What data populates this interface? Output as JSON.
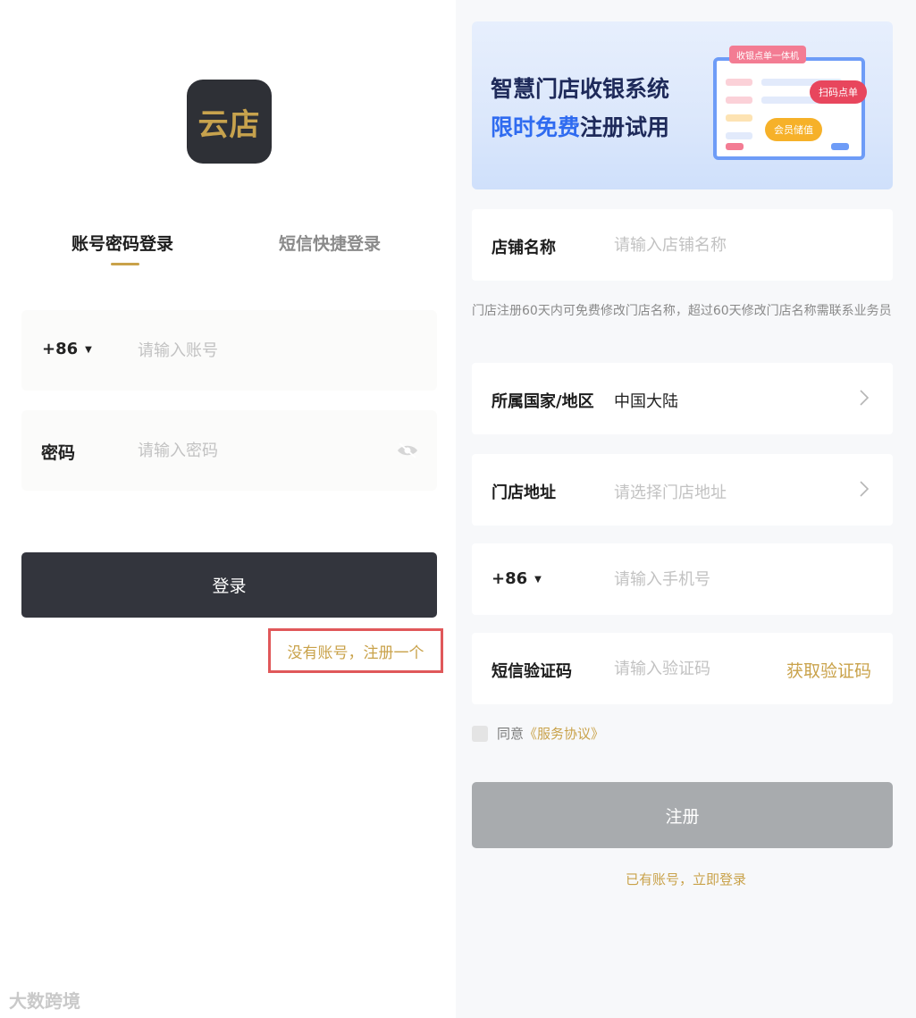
{
  "login": {
    "logo_text": "云店",
    "tab_account": "账号密码登录",
    "tab_sms": "短信快捷登录",
    "country_code": "+86",
    "account_placeholder": "请输入账号",
    "password_label": "密码",
    "password_placeholder": "请输入密码",
    "login_button": "登录",
    "register_link": "没有账号，注册一个",
    "watermark": "大数跨境",
    "accent_color": "#c9a24a"
  },
  "register": {
    "banner": {
      "line1": "智慧门店收银系统",
      "line2_highlight": "限时免费",
      "line2_rest": "注册试用",
      "tag_pos": "收银点单一体机",
      "tag_scan": "扫码点单",
      "tag_member": "会员储值"
    },
    "store_name_label": "店铺名称",
    "store_name_placeholder": "请输入店铺名称",
    "store_hint": "门店注册60天内可免费修改门店名称，超过60天修改门店名称需联系业务员",
    "country_label": "所属国家/地区",
    "country_value": "中国大陆",
    "address_label": "门店地址",
    "address_placeholder": "请选择门店地址",
    "phone_country_code": "+86",
    "phone_placeholder": "请输入手机号",
    "sms_label": "短信验证码",
    "sms_placeholder": "请输入验证码",
    "get_code": "获取验证码",
    "agree_text": "同意",
    "agreement_link": "《服务协议》",
    "register_button": "注册",
    "to_login_link": "已有账号，立即登录"
  }
}
